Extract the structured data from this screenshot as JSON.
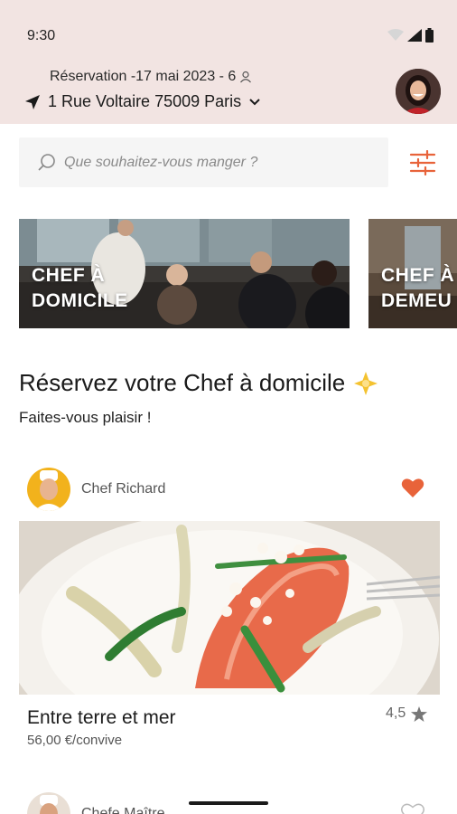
{
  "status": {
    "time": "9:30"
  },
  "header": {
    "reservation": "Réservation -17 mai 2023 - 6",
    "address": "1 Rue Voltaire 75009 Paris"
  },
  "search": {
    "placeholder": "Que souhaitez-vous manger ?"
  },
  "categories": [
    {
      "label": "CHEF À\nDOMICILE"
    },
    {
      "label": "CHEF À\nDEMEU"
    }
  ],
  "section": {
    "title": "Réservez votre Chef à domicile",
    "subtitle": "Faites-vous plaisir !"
  },
  "listing": {
    "chef": "Chef Richard",
    "dish": "Entre terre et mer",
    "price": "56,00 €/convive",
    "rating": "4,5"
  },
  "listing2": {
    "chef": "Chefe Maître"
  },
  "colors": {
    "accent": "#e8633a",
    "header_bg": "#f2e4e2"
  }
}
